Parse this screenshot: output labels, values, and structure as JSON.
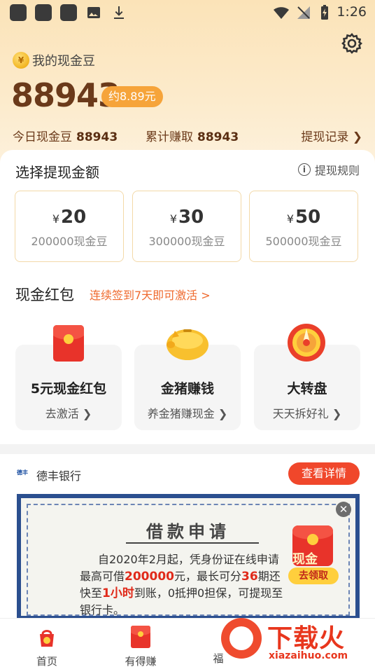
{
  "status_bar": {
    "time": "1:26"
  },
  "header": {
    "title": "我的现金豆",
    "coin_glyph": "¥",
    "balance": "88943",
    "approx": "约8.89元",
    "today_label": "今日现金豆",
    "today_value": "88943",
    "total_label": "累计赚取",
    "total_value": "88943",
    "record_label": "提现记录"
  },
  "withdraw": {
    "title": "选择提现金额",
    "rule_label": "提现规则",
    "currency": "¥",
    "options": [
      {
        "amount": "20",
        "beans": "200000现金豆"
      },
      {
        "amount": "30",
        "beans": "300000现金豆"
      },
      {
        "amount": "50",
        "beans": "500000现金豆"
      }
    ]
  },
  "red_packet": {
    "title": "现金红包",
    "hint": "连续签到7天即可激活 >",
    "features": [
      {
        "title": "5元现金红包",
        "sub": "去激活",
        "icon": "red-envelope-icon"
      },
      {
        "title": "金猪赚钱",
        "sub": "养金猪赚现金",
        "icon": "golden-pig-icon"
      },
      {
        "title": "大转盘",
        "sub": "天天拆好礼",
        "icon": "lucky-wheel-icon"
      }
    ]
  },
  "ad": {
    "bank_logo": "德丰",
    "bank_name": "德丰银行",
    "detail_button": "查看详情",
    "title": "借款申请",
    "line1_a": "自2020年2月起，凭身份证在线申请",
    "line2_a": "最高可借",
    "line2_b": "200000",
    "line2_c": "元，最长可分",
    "line2_d": "36",
    "line2_e": "期还",
    "line3_a": "快至",
    "line3_b": "1小时",
    "line3_c": "到账，0抵押0担保，可提现至",
    "line4": "银行卡。",
    "cash_label": "现金",
    "claim_label": "去领取"
  },
  "tabs": [
    {
      "label": "首页",
      "icon": "home-bag-icon"
    },
    {
      "label": "有得赚",
      "icon": "red-envelope-icon"
    },
    {
      "label": "福",
      "icon": "partial-tab-icon"
    }
  ],
  "watermark": {
    "text": "下载火",
    "url": "xiazaihuo.com"
  },
  "colors": {
    "accent": "#f0472b",
    "brown": "#6b3a1a",
    "orange_badge": "#f6a43a",
    "hint": "#ef6a2e"
  }
}
